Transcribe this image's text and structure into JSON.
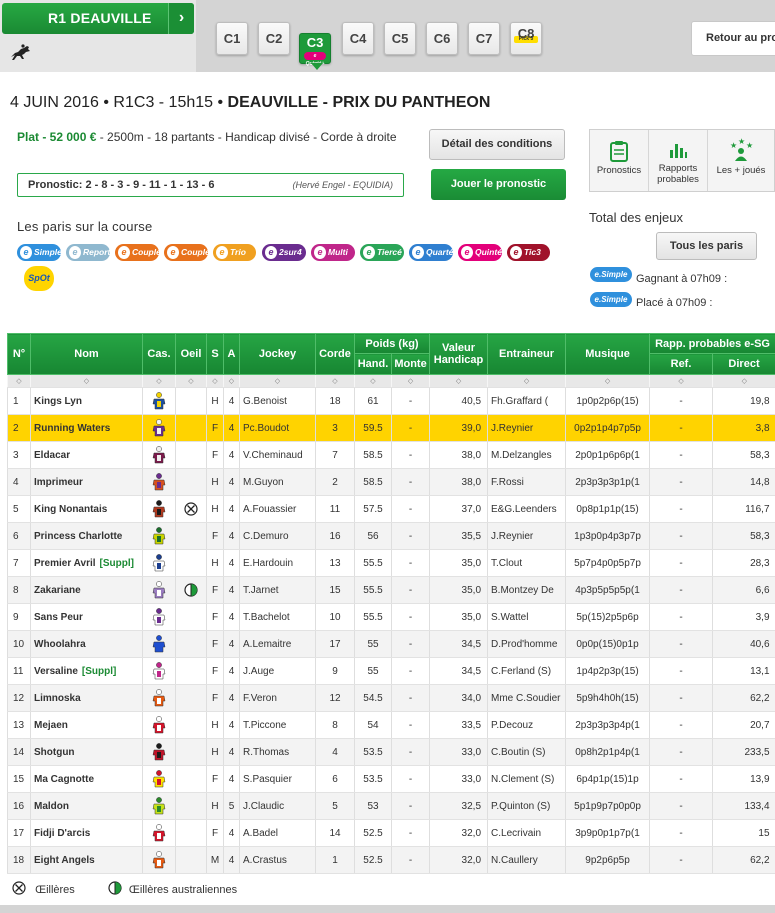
{
  "top": {
    "reunion_label": "R1  DEAUVILLE",
    "arrow": "›",
    "courses": [
      {
        "label": "C1"
      },
      {
        "label": "C2"
      },
      {
        "label": "C3",
        "sub": "e Quinté+"
      },
      {
        "label": "C4"
      },
      {
        "label": "C5"
      },
      {
        "label": "C6"
      },
      {
        "label": "C7"
      },
      {
        "label": "C8",
        "sub": "Pick 5"
      }
    ],
    "retour": "Retour au programme"
  },
  "header": {
    "date_code": "4 JUIN 2016 • R1C3 - 15h15 • ",
    "title_bold": "DEAUVILLE - PRIX DU PANTHEON",
    "cond_green": "Plat - 52 000 €",
    "cond_rest": " - 2500m - 18 partants  - Handicap divisé  - Corde à droite",
    "detail_btn": "Détail des conditions",
    "pronostic_label": "Pronostic: 2 - 8 - 3 - 9 - 11 - 1 - 13 - 6",
    "pronostic_author": "(Hervé Engel - EQUIDIA)",
    "jouer_btn": "Jouer le pronostic"
  },
  "paris": {
    "title": "Les paris sur la course",
    "pills": [
      {
        "label": "Simple",
        "color": "#2f90dd"
      },
      {
        "label": "Report",
        "color": "#8fb8cf"
      },
      {
        "label": "Couplé",
        "color": "#e8711c"
      },
      {
        "label": "Couplé",
        "color": "#e8711c"
      },
      {
        "label": "Trio",
        "color": "#f0a020"
      },
      {
        "label": "2sur4",
        "color": "#6a2c8f"
      },
      {
        "label": "Multi",
        "color": "#c0268a"
      },
      {
        "label": "Tiercé",
        "color": "#2aa558"
      },
      {
        "label": "Quarté+",
        "color": "#2f7fd0"
      },
      {
        "label": "Quinté+",
        "color": "#e3007a"
      },
      {
        "label": "Tic3",
        "color": "#a0122b"
      }
    ],
    "spot": "SpOt"
  },
  "right": {
    "tabs": [
      {
        "label": "Pronostics",
        "icon": "clipboard-icon"
      },
      {
        "label": "Rapports probables",
        "icon": "bar-chart-icon"
      },
      {
        "label": "Les + joués",
        "icon": "stars-person-icon"
      }
    ],
    "total_title": "Total des enjeux",
    "tous_btn": "Tous les paris",
    "esimple": "e.Simple",
    "gagnant": "Gagnant à 07h09 :",
    "place": "Placé à 07h09 :"
  },
  "table": {
    "headers": {
      "num": "N°",
      "nom": "Nom",
      "cas": "Cas.",
      "oeil": "Oeil",
      "s": "S",
      "a": "A",
      "jockey": "Jockey",
      "corde": "Corde",
      "poids": "Poids (kg)",
      "hand": "Hand.",
      "monte": "Monte",
      "valeur": "Valeur Handicap",
      "entraineur": "Entraineur",
      "musique": "Musique",
      "rapp": "Rapp. probables e-SG",
      "ref": "Ref.",
      "direct": "Direct"
    },
    "sort_glyph": "◇",
    "rows": [
      {
        "num": "1",
        "nom": "Kings Lyn",
        "suppl": "",
        "oeil": "",
        "s": "H",
        "a": "4",
        "jockey": "G.Benoist",
        "corde": "18",
        "hand": "61",
        "monte": "-",
        "valeur": "40,5",
        "entraineur": "Fh.Graffard (",
        "musique": "1p0p2p6p(15)",
        "ref": "-",
        "direct": "19,8",
        "silk": [
          "#1c4fa0",
          "#f2d200"
        ]
      },
      {
        "num": "2",
        "nom": "Running Waters",
        "suppl": "",
        "oeil": "",
        "s": "F",
        "a": "4",
        "jockey": "Pc.Boudot",
        "corde": "3",
        "hand": "59.5",
        "monte": "-",
        "valeur": "39,0",
        "entraineur": "J.Reynier",
        "musique": "0p2p1p4p7p5p",
        "ref": "-",
        "direct": "3,8",
        "silk": [
          "#6a2c8f",
          "#f3f3f3"
        ]
      },
      {
        "num": "3",
        "nom": "Eldacar",
        "suppl": "",
        "oeil": "",
        "s": "F",
        "a": "4",
        "jockey": "V.Cheminaud",
        "corde": "7",
        "hand": "58.5",
        "monte": "-",
        "valeur": "38,0",
        "entraineur": "M.Delzangles",
        "musique": "2p0p1p6p6p(1",
        "ref": "-",
        "direct": "58,3",
        "silk": [
          "#7b1a4b",
          "#f0f0f0"
        ]
      },
      {
        "num": "4",
        "nom": "Imprimeur",
        "suppl": "",
        "oeil": "",
        "s": "H",
        "a": "4",
        "jockey": "M.Guyon",
        "corde": "2",
        "hand": "58.5",
        "monte": "-",
        "valeur": "38,0",
        "entraineur": "F.Rossi",
        "musique": "2p3p3p3p1p(1",
        "ref": "-",
        "direct": "14,8",
        "silk": [
          "#d8521f",
          "#6a2c8f"
        ]
      },
      {
        "num": "5",
        "nom": "King Nonantais",
        "suppl": "",
        "oeil": "X",
        "s": "H",
        "a": "4",
        "jockey": "A.Fouassier",
        "corde": "11",
        "hand": "57.5",
        "monte": "-",
        "valeur": "37,0",
        "entraineur": "E&G.Leenders",
        "musique": "0p8p1p1p(15)",
        "ref": "-",
        "direct": "116,7",
        "silk": [
          "#b23a1f",
          "#1b1b1b"
        ]
      },
      {
        "num": "6",
        "nom": "Princess Charlotte",
        "suppl": "",
        "oeil": "",
        "s": "F",
        "a": "4",
        "jockey": "C.Demuro",
        "corde": "16",
        "hand": "56",
        "monte": "-",
        "valeur": "35,5",
        "entraineur": "J.Reynier",
        "musique": "1p3p0p4p3p7p",
        "ref": "-",
        "direct": "58,3",
        "silk": [
          "#c9d400",
          "#1a6f2c"
        ]
      },
      {
        "num": "7",
        "nom": "Premier Avril",
        "suppl": "[Suppl]",
        "oeil": "",
        "s": "H",
        "a": "4",
        "jockey": "E.Hardouin",
        "corde": "13",
        "hand": "55.5",
        "monte": "-",
        "valeur": "35,0",
        "entraineur": "T.Clout",
        "musique": "5p7p4p0p5p7p",
        "ref": "-",
        "direct": "28,3",
        "silk": [
          "#ffffff",
          "#1c3f8f"
        ]
      },
      {
        "num": "8",
        "nom": "Zakariane",
        "suppl": "",
        "oeil": "half",
        "s": "F",
        "a": "4",
        "jockey": "T.Jarnet",
        "corde": "15",
        "hand": "55.5",
        "monte": "-",
        "valeur": "35,0",
        "entraineur": "B.Montzey De",
        "musique": "4p3p5p5p5p(1",
        "ref": "-",
        "direct": "6,6",
        "silk": [
          "#9a7cc0",
          "#ffffff"
        ]
      },
      {
        "num": "9",
        "nom": "Sans Peur",
        "suppl": "",
        "oeil": "",
        "s": "F",
        "a": "4",
        "jockey": "T.Bachelot",
        "corde": "10",
        "hand": "55.5",
        "monte": "-",
        "valeur": "35,0",
        "entraineur": "S.Wattel",
        "musique": "5p(15)2p5p6p",
        "ref": "-",
        "direct": "3,9",
        "silk": [
          "#ffffff",
          "#6a2c8f"
        ]
      },
      {
        "num": "10",
        "nom": "Whoolahra",
        "suppl": "",
        "oeil": "",
        "s": "F",
        "a": "4",
        "jockey": "A.Lemaitre",
        "corde": "17",
        "hand": "55",
        "monte": "-",
        "valeur": "34,5",
        "entraineur": "D.Prod'homme",
        "musique": "0p0p(15)0p1p",
        "ref": "-",
        "direct": "40,6",
        "silk": [
          "#1f4fd0",
          "#1f4fd0"
        ]
      },
      {
        "num": "11",
        "nom": "Versaline",
        "suppl": "[Suppl]",
        "oeil": "",
        "s": "F",
        "a": "4",
        "jockey": "J.Auge",
        "corde": "9",
        "hand": "55",
        "monte": "-",
        "valeur": "34,5",
        "entraineur": "C.Ferland (S)",
        "musique": "1p4p2p3p(15)",
        "ref": "-",
        "direct": "13,1",
        "silk": [
          "#ffffff",
          "#c0268a"
        ]
      },
      {
        "num": "12",
        "nom": "Limnoska",
        "suppl": "",
        "oeil": "",
        "s": "F",
        "a": "4",
        "jockey": "F.Veron",
        "corde": "12",
        "hand": "54.5",
        "monte": "-",
        "valeur": "34,0",
        "entraineur": "Mme C.Soudier",
        "musique": "5p9h4h0h(15)",
        "ref": "-",
        "direct": "62,2",
        "silk": [
          "#e65a12",
          "#ffffff"
        ]
      },
      {
        "num": "13",
        "nom": "Mejaen",
        "suppl": "",
        "oeil": "",
        "s": "H",
        "a": "4",
        "jockey": "T.Piccone",
        "corde": "8",
        "hand": "54",
        "monte": "-",
        "valeur": "33,5",
        "entraineur": "P.Decouz",
        "musique": "2p3p3p3p4p(1",
        "ref": "-",
        "direct": "20,7",
        "silk": [
          "#d4142a",
          "#ffffff"
        ]
      },
      {
        "num": "14",
        "nom": "Shotgun",
        "suppl": "",
        "oeil": "",
        "s": "H",
        "a": "4",
        "jockey": "R.Thomas",
        "corde": "4",
        "hand": "53.5",
        "monte": "-",
        "valeur": "33,0",
        "entraineur": "C.Boutin (S)",
        "musique": "0p8h2p1p4p(1",
        "ref": "-",
        "direct": "233,5",
        "silk": [
          "#c0142a",
          "#1b1b1b"
        ]
      },
      {
        "num": "15",
        "nom": "Ma Cagnotte",
        "suppl": "",
        "oeil": "",
        "s": "F",
        "a": "4",
        "jockey": "S.Pasquier",
        "corde": "6",
        "hand": "53.5",
        "monte": "-",
        "valeur": "33,0",
        "entraineur": "N.Clement (S)",
        "musique": "6p4p1p(15)1p",
        "ref": "-",
        "direct": "13,9",
        "silk": [
          "#ffe500",
          "#d4142a"
        ]
      },
      {
        "num": "16",
        "nom": "Maldon",
        "suppl": "",
        "oeil": "",
        "s": "H",
        "a": "5",
        "jockey": "J.Claudic",
        "corde": "5",
        "hand": "53",
        "monte": "-",
        "valeur": "32,5",
        "entraineur": "P.Quinton (S)",
        "musique": "5p1p9p7p0p0p",
        "ref": "-",
        "direct": "133,4",
        "silk": [
          "#c6e21a",
          "#2a8a2a"
        ]
      },
      {
        "num": "17",
        "nom": "Fidji D'arcis",
        "suppl": "",
        "oeil": "",
        "s": "F",
        "a": "4",
        "jockey": "A.Badel",
        "corde": "14",
        "hand": "52.5",
        "monte": "-",
        "valeur": "32,0",
        "entraineur": "C.Lecrivain",
        "musique": "3p9p0p1p7p(1",
        "ref": "-",
        "direct": "15",
        "silk": [
          "#d4142a",
          "#ffffff"
        ]
      },
      {
        "num": "18",
        "nom": "Eight Angels",
        "suppl": "",
        "oeil": "",
        "s": "M",
        "a": "4",
        "jockey": "A.Crastus",
        "corde": "1",
        "hand": "52.5",
        "monte": "-",
        "valeur": "32,0",
        "entraineur": "N.Caullery",
        "musique": "9p2p6p5p",
        "ref": "-",
        "direct": "62,2",
        "silk": [
          "#e65a12",
          "#ffffff"
        ]
      }
    ]
  },
  "legend": {
    "oeilleres": "Œillères",
    "australiennes": "Œillères australiennes"
  }
}
